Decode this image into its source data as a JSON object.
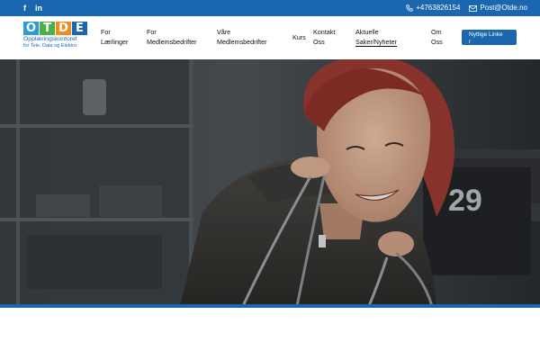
{
  "topbar": {
    "social": [
      {
        "icon": "facebook-icon",
        "text": "f"
      },
      {
        "icon": "linkedin-icon",
        "text": "in"
      }
    ],
    "phone": "+4763826154",
    "email": "Post@Otde.no"
  },
  "logo": {
    "letters": [
      "O",
      "T",
      "D",
      "E"
    ],
    "letter_colors": [
      "#2f9ad6",
      "#4bb04a",
      "#f08c1e",
      "#1a67b0"
    ],
    "line1": "Opplæringskontoret",
    "line2": "for Tele, Data og Elektro"
  },
  "nav": {
    "items": [
      {
        "line1": "For",
        "line2": "Lærlinger"
      },
      {
        "line1": "For",
        "line2": "Medlemsbedrifter"
      },
      {
        "line1": "Våre",
        "line2": "Medlemsbedrifter"
      },
      {
        "line1": "Kurs",
        "line2": ""
      },
      {
        "line1": "Kontakt",
        "line2": "Oss"
      },
      {
        "line1": "Aktuelle",
        "line2": "Saker/Nyheter"
      },
      {
        "line1": "Om",
        "line2": "Oss"
      }
    ],
    "active_index": 5,
    "cta_line1": "Nyttige Linke",
    "cta_line2": "r"
  },
  "hero": {
    "jersey_number": "29"
  },
  "colors": {
    "brand": "#1a67b0",
    "hair": "#9a3b32"
  }
}
